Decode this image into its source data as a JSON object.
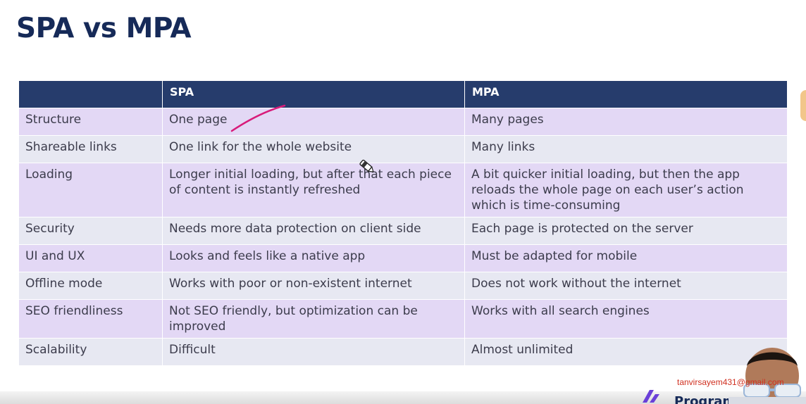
{
  "title": "SPA vs MPA",
  "table": {
    "headers": [
      "",
      "SPA",
      "MPA"
    ],
    "rows": [
      {
        "feature": "Structure",
        "spa": "One page",
        "mpa": "Many pages"
      },
      {
        "feature": "Shareable links",
        "spa": "One link for the whole website",
        "mpa": "Many links"
      },
      {
        "feature": "Loading",
        "spa": "Longer initial loading, but after that each piece of content is instantly refreshed",
        "mpa": "A bit quicker initial loading, but then the app reloads the whole page on each user’s action which is time-consuming"
      },
      {
        "feature": "Security",
        "spa": "Needs more data protection on client side",
        "mpa": "Each page is protected on the server"
      },
      {
        "feature": "UI and UX",
        "spa": "Looks and feels like a native app",
        "mpa": "Must be adapted for mobile"
      },
      {
        "feature": "Offline mode",
        "spa": "Works with poor or non-existent internet",
        "mpa": "Does not work without the internet"
      },
      {
        "feature": "SEO friendliness",
        "spa": "Not SEO friendly, but optimization can be improved",
        "mpa": "Works with all search engines"
      },
      {
        "feature": "Scalability",
        "spa": "Difficult",
        "mpa": "Almost unlimited"
      }
    ]
  },
  "overlay": {
    "email": "tanvirsayem431@gmail.com",
    "logo_text": "Program"
  },
  "colors": {
    "title": "#162a58",
    "header_bg": "#263c6c",
    "row_odd": "#e3d8f5",
    "row_even": "#e7e8f2",
    "pen_stroke": "#d81b7a",
    "email": "#d03020"
  },
  "icons": [
    "pen-cursor-icon",
    "logo-mark-icon"
  ]
}
